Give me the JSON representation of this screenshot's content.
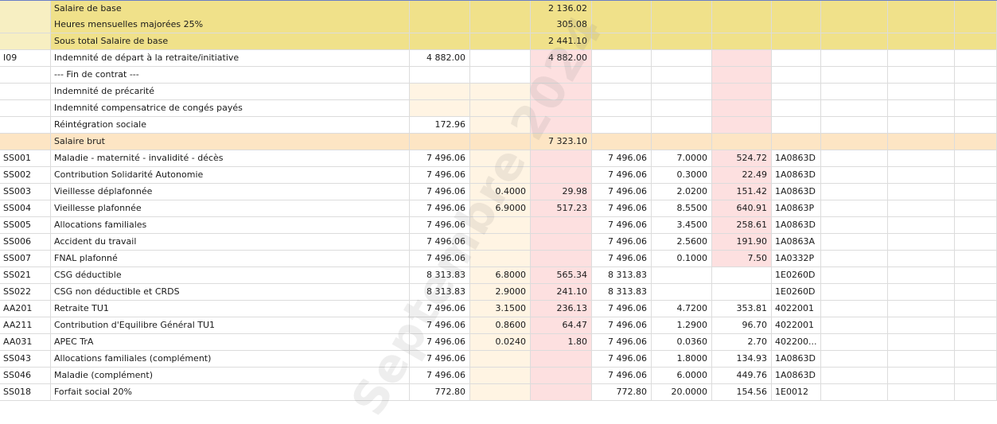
{
  "watermark": "Septembre 2024",
  "colors": {
    "header_yellow": "#f0e18a",
    "brut_peach": "#fde5c4",
    "pink_col": "#fde0e0",
    "cream_col": "#fff4e3"
  },
  "rows": [
    {
      "code": "",
      "label": "Salaire de base",
      "base": "",
      "taux_sal": "",
      "mt_sal": "2 136.02",
      "base_pat": "",
      "taux_pat": "",
      "mt_pat": "",
      "ref": ""
    },
    {
      "code": "",
      "label": "Heures mensuelles majorées 25%",
      "base": "",
      "taux_sal": "",
      "mt_sal": "305.08",
      "base_pat": "",
      "taux_pat": "",
      "mt_pat": "",
      "ref": ""
    },
    {
      "code": "",
      "label": "Sous total Salaire de base",
      "base": "",
      "taux_sal": "",
      "mt_sal": "2 441.10",
      "base_pat": "",
      "taux_pat": "",
      "mt_pat": "",
      "ref": ""
    },
    {
      "code": "I09",
      "label": "Indemnité de départ à la retraite/initiative",
      "base": "4 882.00",
      "taux_sal": "",
      "mt_sal": "4 882.00",
      "base_pat": "",
      "taux_pat": "",
      "mt_pat": "",
      "ref": ""
    },
    {
      "code": "",
      "label": "--- Fin de contrat ---",
      "base": "",
      "taux_sal": "",
      "mt_sal": "",
      "base_pat": "",
      "taux_pat": "",
      "mt_pat": "",
      "ref": ""
    },
    {
      "code": "",
      "label": "Indemnité de précarité",
      "base": "",
      "taux_sal": "",
      "mt_sal": "",
      "base_pat": "",
      "taux_pat": "",
      "mt_pat": "",
      "ref": ""
    },
    {
      "code": "",
      "label": "Indemnité compensatrice de congés payés",
      "base": "",
      "taux_sal": "",
      "mt_sal": "",
      "base_pat": "",
      "taux_pat": "",
      "mt_pat": "",
      "ref": ""
    },
    {
      "code": "",
      "label": "Réintégration sociale",
      "base": "172.96",
      "taux_sal": "",
      "mt_sal": "",
      "base_pat": "",
      "taux_pat": "",
      "mt_pat": "",
      "ref": ""
    },
    {
      "code": "",
      "label": "Salaire brut",
      "base": "",
      "taux_sal": "",
      "mt_sal": "7 323.10",
      "base_pat": "",
      "taux_pat": "",
      "mt_pat": "",
      "ref": ""
    },
    {
      "code": "SS001",
      "label": "Maladie - maternité - invalidité - décès",
      "base": "7 496.06",
      "taux_sal": "",
      "mt_sal": "",
      "base_pat": "7 496.06",
      "taux_pat": "7.0000",
      "mt_pat": "524.72",
      "ref": "1A0863D"
    },
    {
      "code": "SS002",
      "label": "Contribution Solidarité Autonomie",
      "base": "7 496.06",
      "taux_sal": "",
      "mt_sal": "",
      "base_pat": "7 496.06",
      "taux_pat": "0.3000",
      "mt_pat": "22.49",
      "ref": "1A0863D"
    },
    {
      "code": "SS003",
      "label": "Vieillesse déplafonnée",
      "base": "7 496.06",
      "taux_sal": "0.4000",
      "mt_sal": "29.98",
      "base_pat": "7 496.06",
      "taux_pat": "2.0200",
      "mt_pat": "151.42",
      "ref": "1A0863D"
    },
    {
      "code": "SS004",
      "label": "Vieillesse plafonnée",
      "base": "7 496.06",
      "taux_sal": "6.9000",
      "mt_sal": "517.23",
      "base_pat": "7 496.06",
      "taux_pat": "8.5500",
      "mt_pat": "640.91",
      "ref": "1A0863P"
    },
    {
      "code": "SS005",
      "label": "Allocations familiales",
      "base": "7 496.06",
      "taux_sal": "",
      "mt_sal": "",
      "base_pat": "7 496.06",
      "taux_pat": "3.4500",
      "mt_pat": "258.61",
      "ref": "1A0863D"
    },
    {
      "code": "SS006",
      "label": "Accident du travail",
      "base": "7 496.06",
      "taux_sal": "",
      "mt_sal": "",
      "base_pat": "7 496.06",
      "taux_pat": "2.5600",
      "mt_pat": "191.90",
      "ref": "1A0863A"
    },
    {
      "code": "SS007",
      "label": "FNAL plafonné",
      "base": "7 496.06",
      "taux_sal": "",
      "mt_sal": "",
      "base_pat": "7 496.06",
      "taux_pat": "0.1000",
      "mt_pat": "7.50",
      "ref": "1A0332P"
    },
    {
      "code": "SS021",
      "label": "CSG déductible",
      "base": "8 313.83",
      "taux_sal": "6.8000",
      "mt_sal": "565.34",
      "base_pat": "8 313.83",
      "taux_pat": "",
      "mt_pat": "",
      "ref": "1E0260D"
    },
    {
      "code": "SS022",
      "label": "CSG non déductible et CRDS",
      "base": "8 313.83",
      "taux_sal": "2.9000",
      "mt_sal": "241.10",
      "base_pat": "8 313.83",
      "taux_pat": "",
      "mt_pat": "",
      "ref": "1E0260D"
    },
    {
      "code": "AA201",
      "label": "Retraite TU1",
      "base": "7 496.06",
      "taux_sal": "3.1500",
      "mt_sal": "236.13",
      "base_pat": "7 496.06",
      "taux_pat": "4.7200",
      "mt_pat": "353.81",
      "ref": "4022001"
    },
    {
      "code": "AA211",
      "label": "Contribution d'Equilibre Général TU1",
      "base": "7 496.06",
      "taux_sal": "0.8600",
      "mt_sal": "64.47",
      "base_pat": "7 496.06",
      "taux_pat": "1.2900",
      "mt_pat": "96.70",
      "ref": "4022001"
    },
    {
      "code": "AA031",
      "label": "APEC TrA",
      "base": "7 496.06",
      "taux_sal": "0.0240",
      "mt_sal": "1.80",
      "base_pat": "7 496.06",
      "taux_pat": "0.0360",
      "mt_pat": "2.70",
      "ref": "402200..."
    },
    {
      "code": "SS043",
      "label": "Allocations familiales (complément)",
      "base": "7 496.06",
      "taux_sal": "",
      "mt_sal": "",
      "base_pat": "7 496.06",
      "taux_pat": "1.8000",
      "mt_pat": "134.93",
      "ref": "1A0863D"
    },
    {
      "code": "SS046",
      "label": "Maladie (complément)",
      "base": "7 496.06",
      "taux_sal": "",
      "mt_sal": "",
      "base_pat": "7 496.06",
      "taux_pat": "6.0000",
      "mt_pat": "449.76",
      "ref": "1A0863D"
    },
    {
      "code": "SS018",
      "label": "Forfait social 20%",
      "base": "772.80",
      "taux_sal": "",
      "mt_sal": "",
      "base_pat": "772.80",
      "taux_pat": "20.0000",
      "mt_pat": "154.56",
      "ref": "1E0012"
    }
  ]
}
